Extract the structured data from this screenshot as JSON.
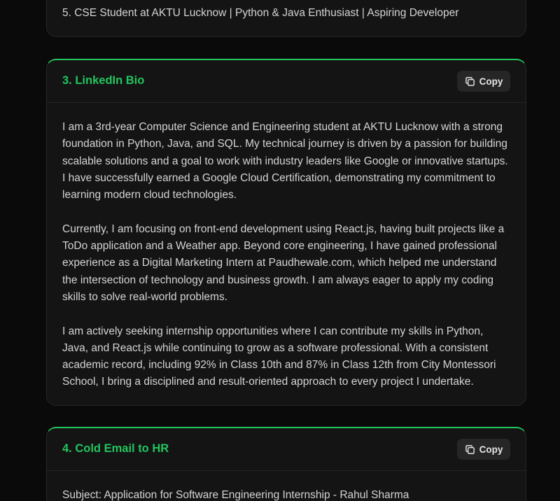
{
  "previous_card": {
    "last_item": "5. CSE Student at AKTU Lucknow | Python & Java Enthusiast | Aspiring Developer"
  },
  "linkedin_bio": {
    "title": "3. LinkedIn Bio",
    "copy_label": "Copy",
    "paragraphs": [
      "I am a 3rd-year Computer Science and Engineering student at AKTU Lucknow with a strong foundation in Python, Java, and SQL. My technical journey is driven by a passion for building scalable solutions and a goal to work with industry leaders like Google or innovative startups. I have successfully earned a Google Cloud Certification, demonstrating my commitment to learning modern cloud technologies.",
      "Currently, I am focusing on front-end development using React.js, having built projects like a ToDo application and a Weather app. Beyond core engineering, I have gained professional experience as a Digital Marketing Intern at Paudhewale.com, which helped me understand the intersection of technology and business growth. I am always eager to apply my coding skills to solve real-world problems.",
      "I am actively seeking internship opportunities where I can contribute my skills in Python, Java, and React.js while continuing to grow as a software professional. With a consistent academic record, including 92% in Class 10th and 87% in Class 12th from City Montessori School, I bring a disciplined and result-oriented approach to every project I undertake."
    ]
  },
  "cold_email": {
    "title": "4. Cold Email to HR",
    "copy_label": "Copy",
    "subject": "Subject: Application for Software Engineering Internship - Rahul Sharma"
  },
  "icons": {
    "copy": "copy-icon"
  },
  "colors": {
    "background": "#0a0a0a",
    "card": "#141414",
    "border": "#262626",
    "accent_green": "#22c55e",
    "button": "#262626",
    "text": "#d4d4d4"
  }
}
